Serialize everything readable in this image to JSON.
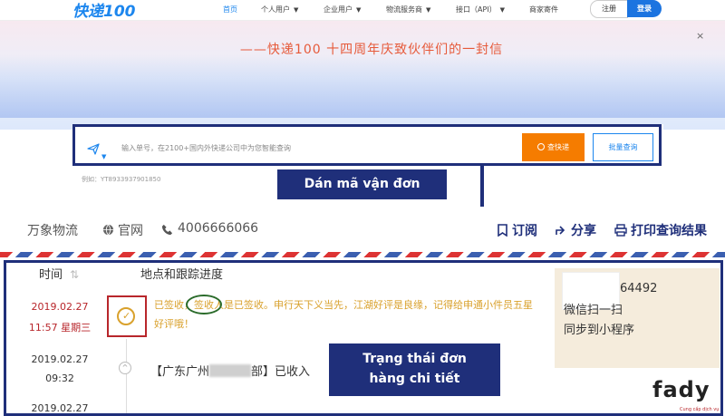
{
  "nav": {
    "logo": "快递100",
    "items": [
      {
        "label": "首页",
        "active": true,
        "caret": false
      },
      {
        "label": "个人用户",
        "caret": true
      },
      {
        "label": "企业用户",
        "caret": true
      },
      {
        "label": "物流服务商",
        "caret": true
      },
      {
        "label": "接口（API）",
        "caret": true
      },
      {
        "label": "商家寄件",
        "caret": false
      }
    ],
    "register": "注册",
    "login": "登录"
  },
  "banner": {
    "title": "——快递100 十四周年庆致伙伴们的一封信",
    "close": "×"
  },
  "search": {
    "placeholder": "输入单号，在2100+国内外快递公司中为您智能查询",
    "search_button": "查快递",
    "batch_button": "批量查询",
    "example": "例如：YT8933937901850",
    "icon": "paper-plane-icon"
  },
  "callouts": {
    "paste": "Dán mã vận đơn",
    "status_line1": "Trạng thái đơn",
    "status_line2": "hàng chi tiết"
  },
  "carrier": {
    "name": "万象物流",
    "website": "官网",
    "phone": "4006666066",
    "actions": {
      "subscribe": "订阅",
      "share": "分享",
      "print": "打印查询结果"
    }
  },
  "tracking": {
    "col_time": "时间",
    "col_location": "地点和跟踪进度",
    "events": [
      {
        "date": "2019.02.27",
        "time": "11:57 星期三",
        "text": "已签收，签收人是已签收。申行天下义当先，江湖好评是良缘，记得给申通小件员五星好评哦！"
      },
      {
        "date": "2019.02.27",
        "time": "09:32",
        "text_prefix": "【广东广州",
        "text_suffix": "部】已收入"
      },
      {
        "date": "2019.02.27",
        "time": ""
      }
    ]
  },
  "mini_program": {
    "number": "64492",
    "line1": "微信扫一扫",
    "line2": "同步到小程序"
  },
  "watermark": {
    "brand": "fady",
    "sub": "Cung cấp dịch vụ"
  },
  "colors": {
    "brand_blue": "#1c86ee",
    "callout_navy": "#1f2f7a",
    "search_orange": "#f57c00",
    "sign_gold": "#d9a12c",
    "highlight_red": "#b8262b"
  }
}
